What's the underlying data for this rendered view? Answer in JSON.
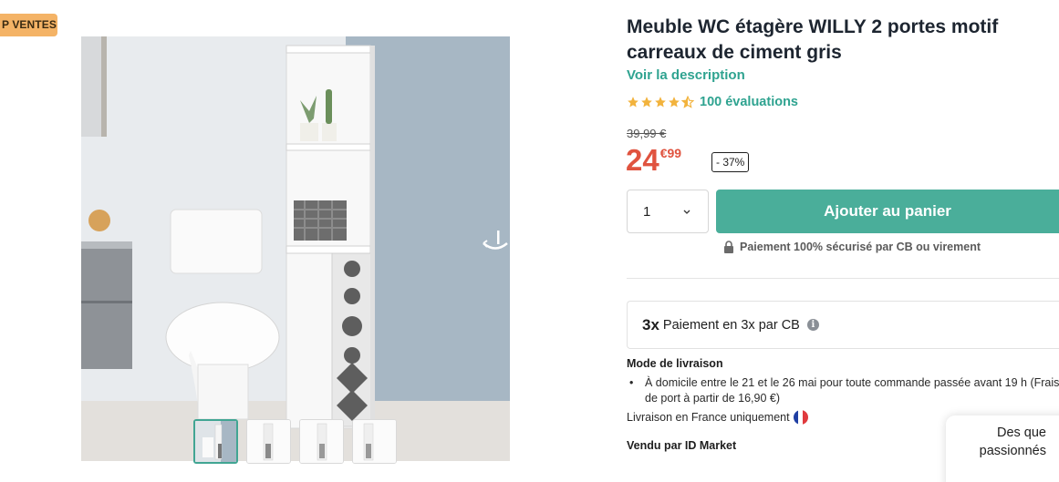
{
  "badge": {
    "label": "P VENTES"
  },
  "product": {
    "title": "Meuble WC étagère WILLY 2 portes motif carreaux de ciment gris",
    "description_link": "Voir la description",
    "rating": {
      "stars": 4.5,
      "count_label": "100 évaluations"
    },
    "old_price": "39,99 €",
    "price_int": "24",
    "price_dec": "€99",
    "discount": "- 37%"
  },
  "cart": {
    "quantity": "1",
    "add_label": "Ajouter au panier",
    "secure_label": "Paiement 100% sécurisé par CB ou virement"
  },
  "payment3x": {
    "prefix": "3x",
    "label": "Paiement en 3x par CB",
    "info": "i"
  },
  "delivery": {
    "title": "Mode de livraison",
    "items": [
      "À domicile entre le 21 et le 26 mai pour toute commande passée avant 19 h (Frais de port à partir de 16,90 €)"
    ],
    "france_only": "Livraison en France uniquement"
  },
  "seller": {
    "label": "Vendu par ID Market"
  },
  "chat": {
    "line1": "Des que",
    "line2": "passionnés"
  },
  "gallery": {
    "thumb_count": 4,
    "active_index": 0
  },
  "colors": {
    "accent": "#4aae9a",
    "link": "#2fa390",
    "price": "#e0533f",
    "badge": "#f4b366",
    "star": "#f2b33d"
  }
}
